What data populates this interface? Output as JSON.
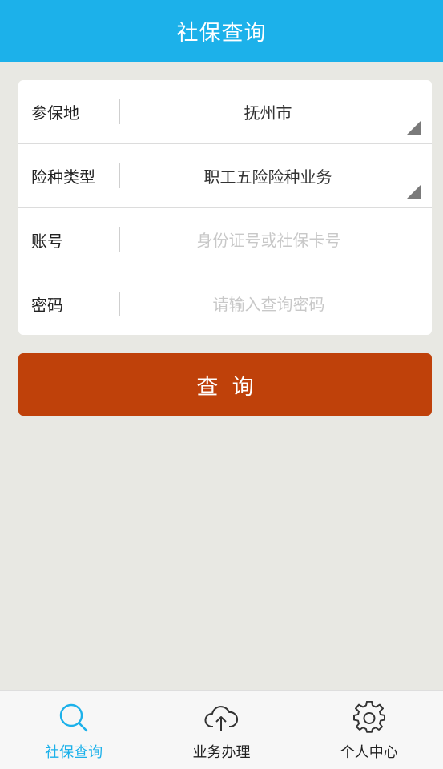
{
  "header": {
    "title": "社保查询"
  },
  "form": {
    "rows": [
      {
        "label": "参保地",
        "value": "抚州市"
      },
      {
        "label": "险种类型",
        "value": "职工五险险种业务"
      },
      {
        "label": "账号",
        "placeholder": "身份证号或社保卡号"
      },
      {
        "label": "密码",
        "placeholder": "请输入查询密码"
      }
    ]
  },
  "query_button": {
    "label": "查  询"
  },
  "tabbar": {
    "items": [
      {
        "label": "社保查询",
        "icon": "search-icon",
        "active": true
      },
      {
        "label": "业务办理",
        "icon": "cloud-upload-icon",
        "active": false
      },
      {
        "label": "个人中心",
        "icon": "gear-icon",
        "active": false
      }
    ]
  },
  "colors": {
    "header": "#1cb1ea",
    "primary_button": "#bf410a",
    "background": "#e8e8e3",
    "active_tab": "#1cb1ea"
  }
}
